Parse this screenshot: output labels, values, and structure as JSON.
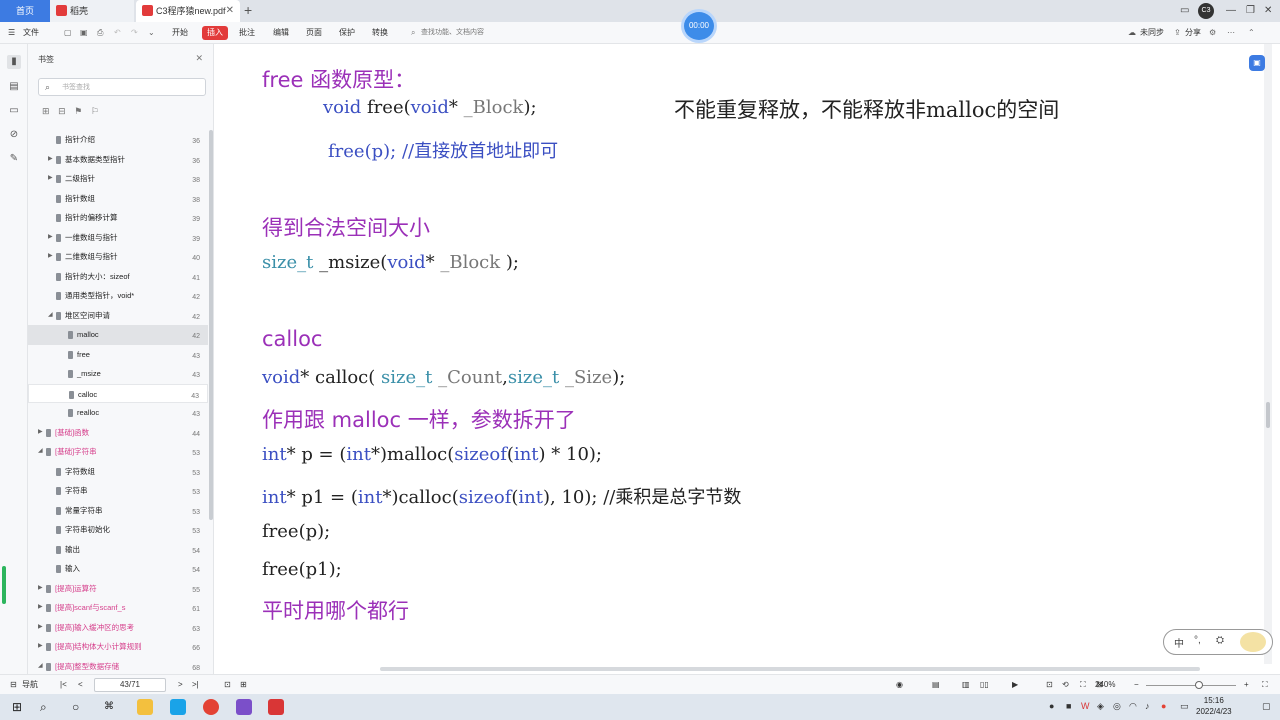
{
  "titlebar": {
    "tabs": [
      {
        "label": "首页"
      },
      {
        "label": "稻壳"
      },
      {
        "label": "C3程序猿new.pdf"
      }
    ],
    "new_tab": "+",
    "recording_time": "00:00",
    "user_badge": "C3"
  },
  "toolbar": {
    "menu": "文件",
    "items": [
      "开始",
      "插入",
      "批注",
      "编辑",
      "页面",
      "保护",
      "转换"
    ],
    "search_placeholder": "查找功能、文档内容",
    "sync": "未同步",
    "share": "分享"
  },
  "bookmarks": {
    "title": "书签",
    "search_placeholder": "书签查找",
    "items": [
      {
        "label": "指针介绍",
        "page": "36",
        "indent": 1,
        "arrow": false
      },
      {
        "label": "基本数据类型指针",
        "page": "36",
        "indent": 1,
        "arrow": true
      },
      {
        "label": "二级指针",
        "page": "38",
        "indent": 1,
        "arrow": true
      },
      {
        "label": "指针数组",
        "page": "38",
        "indent": 1,
        "arrow": false
      },
      {
        "label": "指针的偏移计算",
        "page": "39",
        "indent": 1,
        "arrow": false
      },
      {
        "label": "一维数组与指针",
        "page": "39",
        "indent": 1,
        "arrow": true
      },
      {
        "label": "二维数组与指针",
        "page": "40",
        "indent": 1,
        "arrow": true
      },
      {
        "label": "指针的大小：sizeof",
        "page": "41",
        "indent": 1,
        "arrow": false
      },
      {
        "label": "通用类型指针，void*",
        "page": "42",
        "indent": 1,
        "arrow": false
      },
      {
        "label": "堆区空间申请",
        "page": "42",
        "indent": 1,
        "arrow": "open"
      },
      {
        "label": "malloc",
        "page": "42",
        "indent": 2,
        "arrow": false,
        "state": "selected"
      },
      {
        "label": "free",
        "page": "43",
        "indent": 2,
        "arrow": false
      },
      {
        "label": "_msize",
        "page": "43",
        "indent": 2,
        "arrow": false
      },
      {
        "label": "calloc",
        "page": "43",
        "indent": 2,
        "arrow": false,
        "state": "hover"
      },
      {
        "label": "realloc",
        "page": "43",
        "indent": 2,
        "arrow": false
      },
      {
        "label": "[基础]函数",
        "page": "44",
        "indent": 0,
        "arrow": true,
        "pink": true
      },
      {
        "label": "[基础]字符串",
        "page": "53",
        "indent": 0,
        "arrow": "open",
        "pink": true
      },
      {
        "label": "字符数组",
        "page": "53",
        "indent": 1,
        "arrow": false
      },
      {
        "label": "字符串",
        "page": "53",
        "indent": 1,
        "arrow": false
      },
      {
        "label": "常量字符串",
        "page": "53",
        "indent": 1,
        "arrow": false
      },
      {
        "label": "字符串初始化",
        "page": "53",
        "indent": 1,
        "arrow": false
      },
      {
        "label": "输出",
        "page": "54",
        "indent": 1,
        "arrow": false
      },
      {
        "label": "输入",
        "page": "54",
        "indent": 1,
        "arrow": false
      },
      {
        "label": "[提高]运算符",
        "page": "55",
        "indent": 0,
        "arrow": true,
        "pink": true
      },
      {
        "label": "[提高]scanf与scanf_s",
        "page": "61",
        "indent": 0,
        "arrow": true,
        "pink": true
      },
      {
        "label": "[提高]输入缓冲区的思考",
        "page": "63",
        "indent": 0,
        "arrow": true,
        "pink": true
      },
      {
        "label": "[提高]结构体大小计算规则",
        "page": "66",
        "indent": 0,
        "arrow": true,
        "pink": true
      },
      {
        "label": "[提高]整型数据存储",
        "page": "68",
        "indent": 0,
        "arrow": "open",
        "pink": true
      }
    ]
  },
  "document": {
    "h_free": "free 函数原型：",
    "free_proto": {
      "kw": "void",
      "name": " free(",
      "kw2": "void",
      "star": "* ",
      "param": "_Block",
      "end": ");"
    },
    "free_note": "不能重复释放，不能释放非malloc的空间",
    "free_call": "free(p);  ",
    "free_comment": "//直接放首地址即可",
    "h_size": "得到合法空间大小",
    "msize_proto": {
      "ty": "size_t",
      "name": " _msize(",
      "kw": "void",
      "star": "* ",
      "param": "_Block",
      "end": " );"
    },
    "h_calloc": "calloc",
    "calloc_proto": {
      "kw": "void",
      "mid": "* calloc( ",
      "ty1": "size_t",
      "p1": " _Count",
      "comma": ",",
      "ty2": "size_t",
      "p2": " _Size",
      "end": ");"
    },
    "h_calloc_note": "作用跟 malloc 一样，参数拆开了",
    "line1": {
      "kw": "int",
      "a": "* p = (",
      "kw2": "int",
      "b": "*)malloc(",
      "kw3": "sizeof",
      "c": "(",
      "kw4": "int",
      "d": ") * 10);"
    },
    "line2": {
      "kw": "int",
      "a": "* p1 = (",
      "kw2": "int",
      "b": "*)calloc(",
      "kw3": "sizeof",
      "c": "(",
      "kw4": "int",
      "d": "), 10); ",
      "comment": "//乘积是总字节数"
    },
    "line3": "free(p);",
    "line4": "free(p1);",
    "h_which": "平时用哪个都行"
  },
  "status": {
    "nav": "导航",
    "page": "43/71",
    "zoom": "240%"
  },
  "ime": {
    "lang": "中",
    "punct": "°,"
  },
  "clock": {
    "time": "15:16",
    "date": "2022/4/23"
  }
}
